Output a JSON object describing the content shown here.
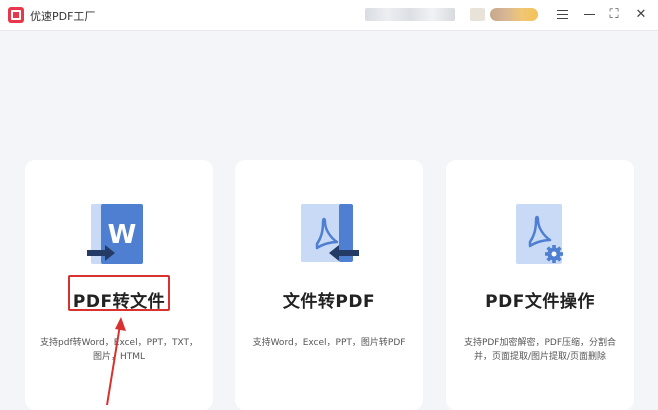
{
  "app": {
    "title": "优速PDF工厂"
  },
  "window_controls": {
    "menu": "menu-icon",
    "minimize": "minimize-icon",
    "maximize_symbol": "⛶",
    "close_symbol": "✕"
  },
  "colors": {
    "accent_blue": "#4f7fd1",
    "light_blue": "#c9daf6",
    "highlight_red": "#d7322f",
    "brand_red": "#e8374a"
  },
  "cards": [
    {
      "title": "PDF转文件",
      "description": "支持pdf转Word，Excel，PPT，TXT，图片，HTML",
      "icon": "pdf-to-word-icon",
      "icon_letter": "W"
    },
    {
      "title": "文件转PDF",
      "description": "支持Word，Excel，PPT，图片转PDF",
      "icon": "file-to-pdf-icon"
    },
    {
      "title": "PDF文件操作",
      "description": "支持PDF加密解密，PDF压缩，分割合并，页面提取/图片提取/页面删除",
      "icon": "pdf-operations-icon"
    }
  ]
}
